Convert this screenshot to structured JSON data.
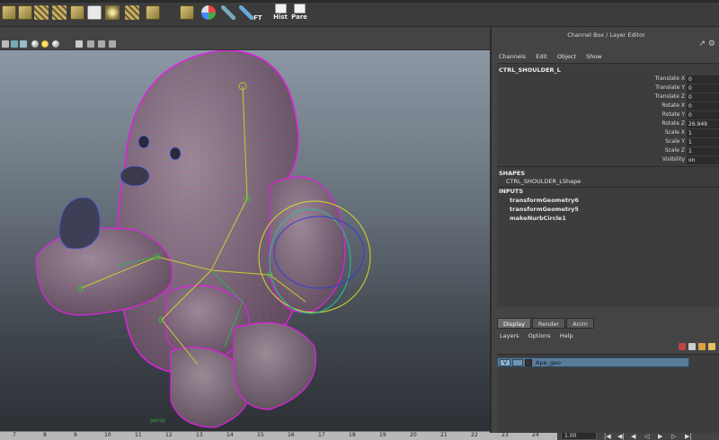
{
  "shelf": {
    "ft_label": "FT",
    "hist_label": "Hist",
    "pare_label": "Pare",
    "icons": [
      "tile-icon",
      "tile-icon",
      "grid-icon",
      "grid-icon",
      "tile-icon",
      "check-icon",
      "star-icon",
      "grid-icon",
      "tile-icon",
      "tile-icon",
      "cone-icon",
      "joint-icon"
    ]
  },
  "viewport": {
    "camera_label": "persp"
  },
  "channel_box": {
    "panel_title": "Channel Box / Layer Editor",
    "menu": [
      "Channels",
      "Edit",
      "Object",
      "Show"
    ],
    "node_name": "CTRL_SHOULDER_L",
    "attributes": [
      {
        "label": "Translate X",
        "value": "0"
      },
      {
        "label": "Translate Y",
        "value": "0"
      },
      {
        "label": "Translate Z",
        "value": "0"
      },
      {
        "label": "Rotate X",
        "value": "0"
      },
      {
        "label": "Rotate Y",
        "value": "0"
      },
      {
        "label": "Rotate Z",
        "value": "26.949"
      },
      {
        "label": "Scale X",
        "value": "1"
      },
      {
        "label": "Scale Y",
        "value": "1"
      },
      {
        "label": "Scale Z",
        "value": "1"
      },
      {
        "label": "Visibility",
        "value": "on"
      }
    ],
    "shapes_header": "SHAPES",
    "shape_item": "CTRL_SHOULDER_LShape",
    "inputs_header": "INPUTS",
    "inputs": [
      "transformGeometry6",
      "transformGeometry5",
      "makeNurbCircle1"
    ]
  },
  "layer_editor": {
    "tabs": [
      "Display",
      "Render",
      "Anim"
    ],
    "menu": [
      "Layers",
      "Options",
      "Help"
    ],
    "layer": {
      "visible_flag": "V",
      "name": "Ape_geo"
    }
  },
  "timeline": {
    "ticks": [
      "7",
      "8",
      "9",
      "10",
      "11",
      "12",
      "13",
      "14",
      "15",
      "16",
      "17",
      "18",
      "19",
      "20",
      "21",
      "22",
      "23",
      "24"
    ],
    "current_time": "1.00"
  },
  "colors": {
    "wire": "#e020e0",
    "layer_selected": "#5a7c9a"
  }
}
